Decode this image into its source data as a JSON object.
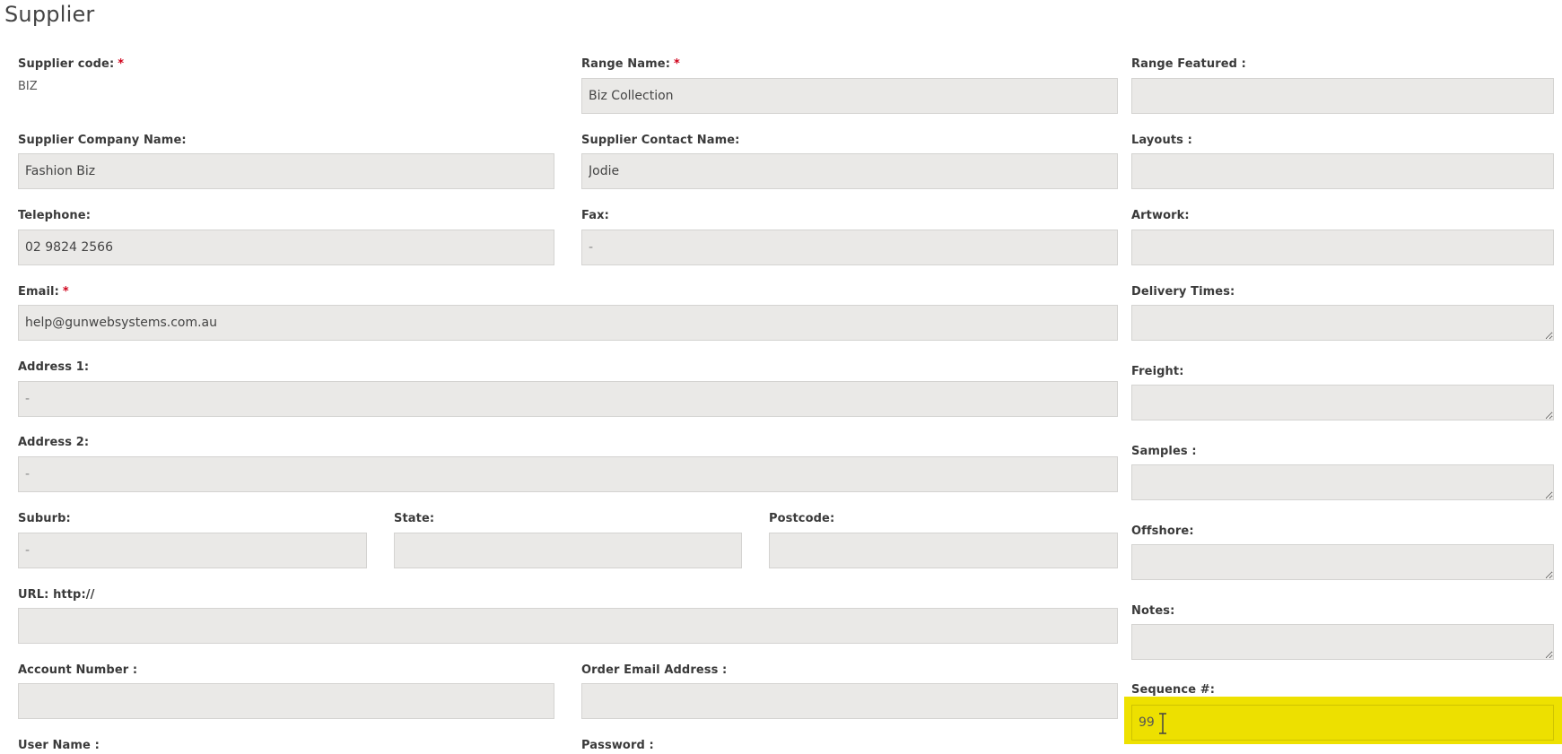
{
  "page": {
    "title": "Supplier"
  },
  "left": {
    "supplier_code": {
      "label": "Supplier code:",
      "required_mark": "*",
      "value": "BIZ"
    },
    "company_name": {
      "label": "Supplier Company Name:",
      "value": "Fashion Biz"
    },
    "telephone": {
      "label": "Telephone:",
      "value": "02 9824 2566"
    },
    "email": {
      "label": "Email:",
      "required_mark": "*",
      "value": "help@gunwebsystems.com.au"
    },
    "address1": {
      "label": "Address 1:",
      "value": "-"
    },
    "address2": {
      "label": "Address 2:",
      "value": "-"
    },
    "suburb": {
      "label": "Suburb:",
      "value": "-"
    },
    "state": {
      "label": "State:",
      "value": ""
    },
    "postcode": {
      "label": "Postcode:",
      "value": ""
    },
    "url": {
      "label": "URL: http://",
      "value": ""
    },
    "account_number": {
      "label": "Account Number :",
      "value": ""
    },
    "user_name": {
      "label": "User Name :"
    }
  },
  "middle": {
    "range_name": {
      "label": "Range Name:",
      "required_mark": "*",
      "value": "Biz Collection"
    },
    "contact_name": {
      "label": "Supplier Contact Name:",
      "value": "Jodie"
    },
    "fax": {
      "label": "Fax:",
      "value": "-"
    },
    "order_email": {
      "label": "Order Email Address :",
      "value": ""
    },
    "password": {
      "label": "Password :"
    }
  },
  "right": {
    "range_featured": {
      "label": "Range Featured :",
      "value": ""
    },
    "layouts": {
      "label": "Layouts :",
      "value": ""
    },
    "artwork": {
      "label": "Artwork:",
      "value": ""
    },
    "delivery_times": {
      "label": "Delivery Times:",
      "value": ""
    },
    "freight": {
      "label": "Freight:",
      "value": ""
    },
    "samples": {
      "label": "Samples :",
      "value": ""
    },
    "offshore": {
      "label": "Offshore:",
      "value": ""
    },
    "notes": {
      "label": "Notes:",
      "value": ""
    },
    "sequence": {
      "label": "Sequence #:",
      "value": "99"
    }
  },
  "icons": {
    "cursor": "text-cursor-icon"
  },
  "colors": {
    "field_bg": "#eae9e7",
    "required": "#d0021b",
    "highlight": "#eee100"
  }
}
